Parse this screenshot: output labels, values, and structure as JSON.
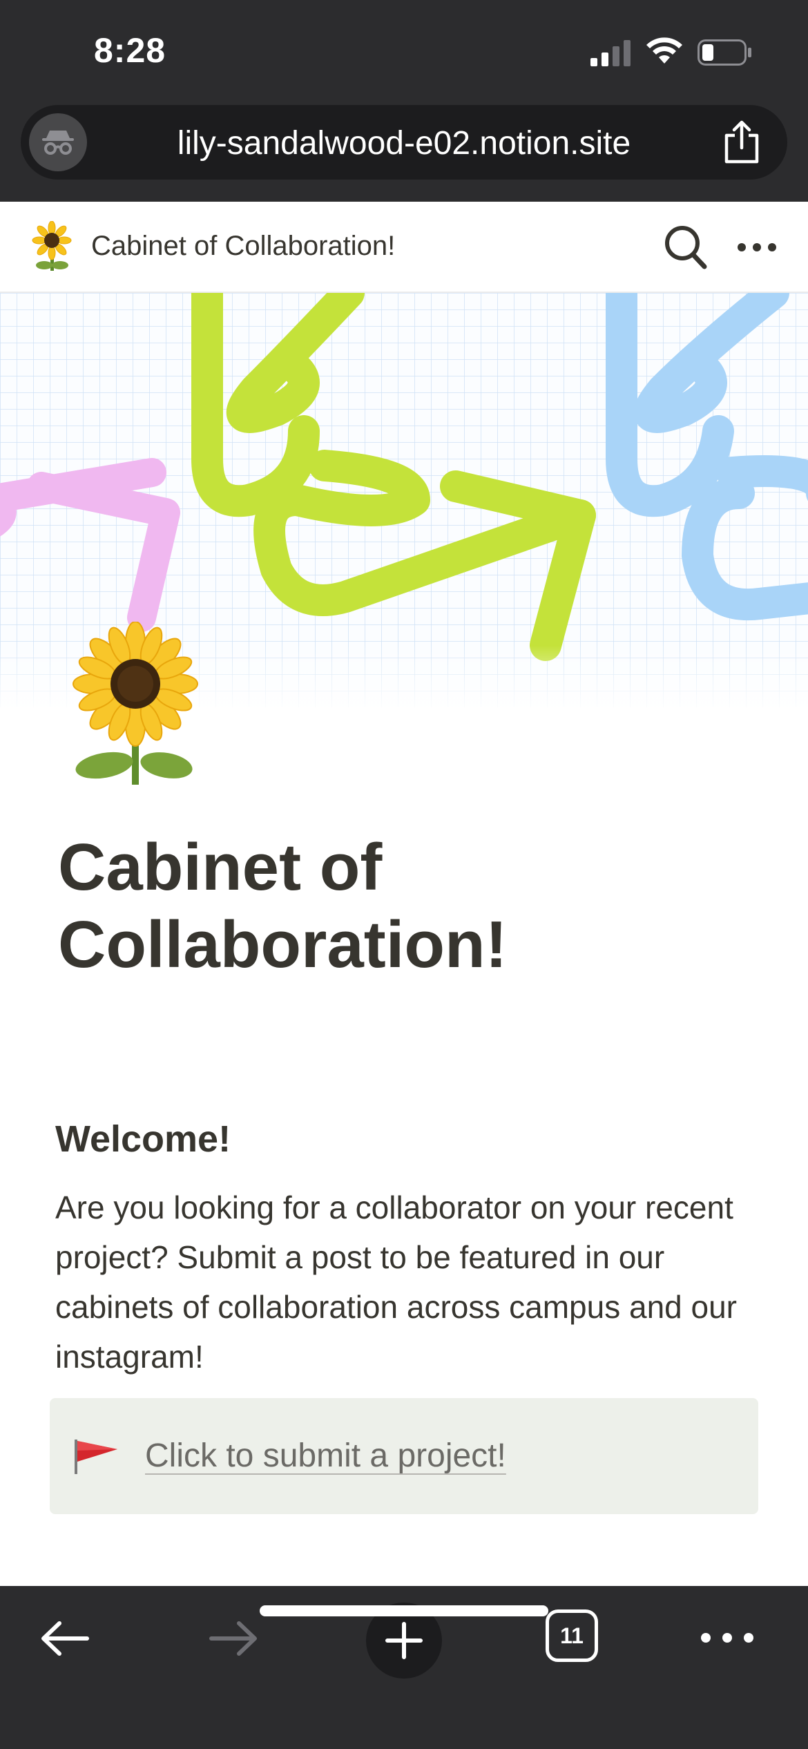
{
  "status_bar": {
    "time": "8:28"
  },
  "browser": {
    "url": "lily-sandalwood-e02.notion.site",
    "tab_count": "11"
  },
  "notion_header": {
    "emoji": "sunflower",
    "title": "Cabinet of Collaboration!"
  },
  "page": {
    "title": "Cabinet of Collaboration!",
    "section_heading": "Welcome!",
    "body": "Are you looking for a collaborator on your recent project? Submit a post to be featured in our cabinets of collaboration across campus and our instagram!",
    "callout": {
      "icon": "red-flag-icon",
      "link_text": "Click to submit a project!",
      "background": "#edf0ea"
    }
  },
  "colors": {
    "chrome_bg": "#2c2c2e",
    "url_bar_bg": "#1c1c1e",
    "text": "#37352f",
    "cover_green": "#c4e23a",
    "cover_pink": "#f0b8f0",
    "cover_blue": "#a9d4f8"
  }
}
